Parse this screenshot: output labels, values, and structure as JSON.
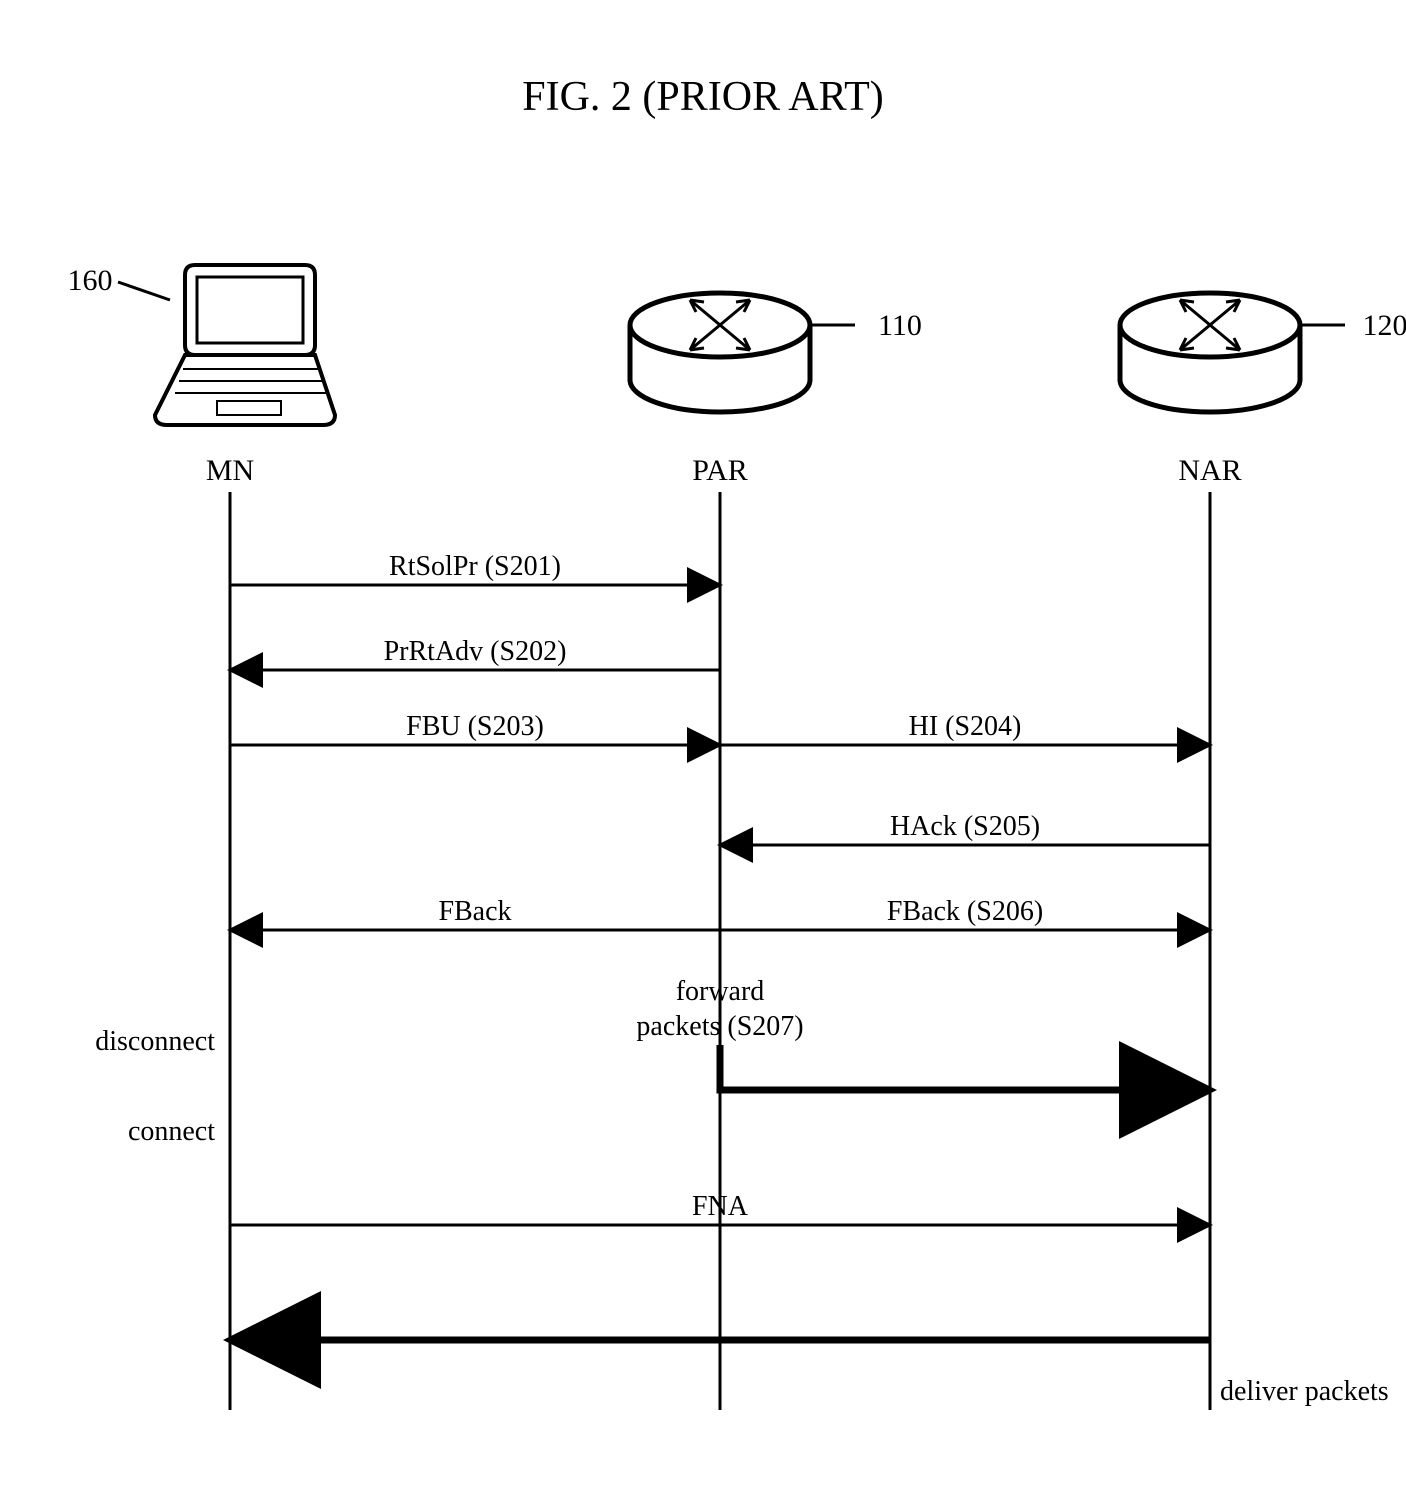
{
  "title": "FIG. 2 (PRIOR ART)",
  "nodes": {
    "mn": {
      "label": "MN",
      "ref": "160"
    },
    "par": {
      "label": "PAR",
      "ref": "110"
    },
    "nar": {
      "label": "NAR",
      "ref": "120"
    }
  },
  "messages": {
    "m1": "RtSolPr (S201)",
    "m2": "PrRtAdv (S202)",
    "m3": "FBU (S203)",
    "m4": "HI (S204)",
    "m5": "HAck (S205)",
    "m6a": "FBack",
    "m6b": "FBack (S206)",
    "m7a": "forward",
    "m7b": "packets (S207)",
    "m8": "FNA",
    "m9": "deliver packets"
  },
  "events": {
    "disconnect": "disconnect",
    "connect": "connect"
  },
  "chart_data": {
    "type": "sequence-diagram",
    "title": "FIG. 2 (PRIOR ART)",
    "lifelines": [
      {
        "id": "MN",
        "ref": "160",
        "icon": "laptop"
      },
      {
        "id": "PAR",
        "ref": "110",
        "icon": "router"
      },
      {
        "id": "NAR",
        "ref": "120",
        "icon": "router"
      }
    ],
    "messages": [
      {
        "from": "MN",
        "to": "PAR",
        "label": "RtSolPr (S201)"
      },
      {
        "from": "PAR",
        "to": "MN",
        "label": "PrRtAdv (S202)"
      },
      {
        "from": "MN",
        "to": "PAR",
        "label": "FBU (S203)"
      },
      {
        "from": "PAR",
        "to": "NAR",
        "label": "HI (S204)"
      },
      {
        "from": "NAR",
        "to": "PAR",
        "label": "HAck (S205)"
      },
      {
        "from": "PAR",
        "to": "MN",
        "label": "FBack"
      },
      {
        "from": "PAR",
        "to": "NAR",
        "label": "FBack (S206)"
      },
      {
        "from": "PAR",
        "to": "NAR",
        "label": "forward packets (S207)",
        "bold": true
      },
      {
        "from": "MN",
        "to": "NAR",
        "label": "FNA"
      },
      {
        "from": "NAR",
        "to": "MN",
        "label": "deliver packets",
        "bold": true
      }
    ],
    "lifeline_events": [
      {
        "on": "MN",
        "label": "disconnect"
      },
      {
        "on": "MN",
        "label": "connect"
      }
    ]
  }
}
